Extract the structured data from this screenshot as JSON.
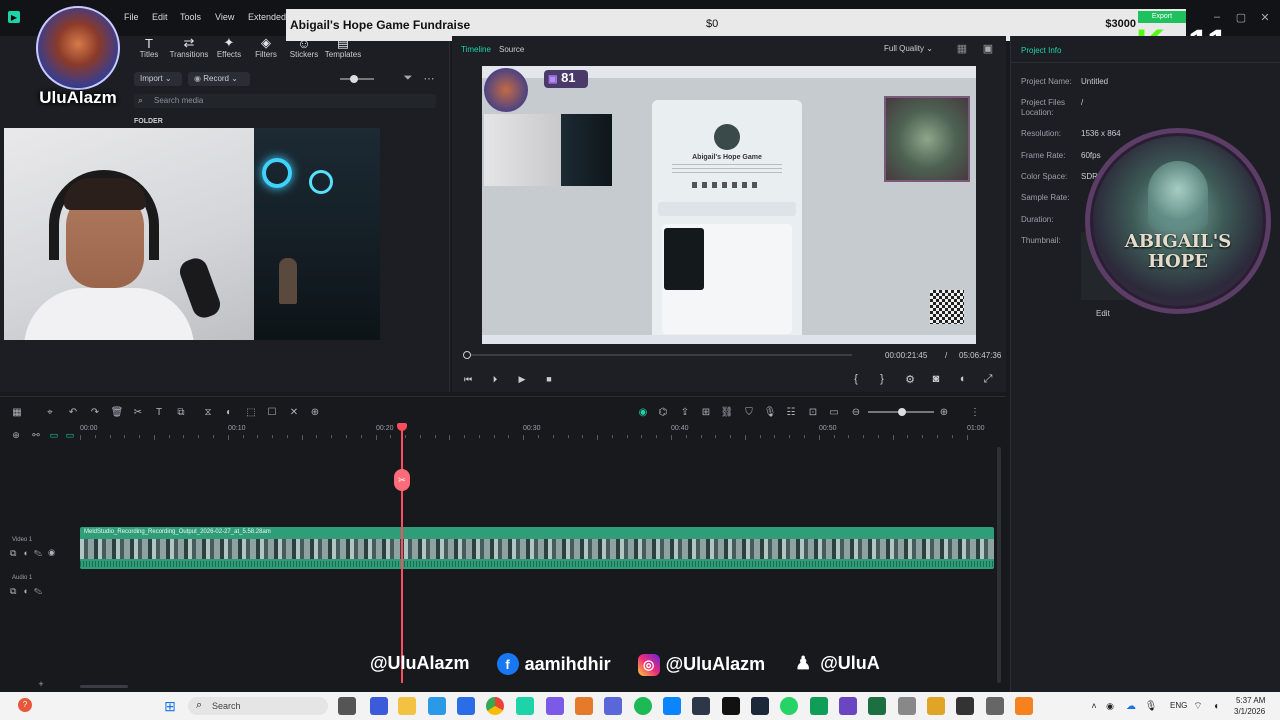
{
  "menu": [
    "File",
    "Edit",
    "Tools",
    "View",
    "Extended"
  ],
  "fundraiser": {
    "title": "Abigail's Hope Game Fundraise",
    "raised": "$0",
    "goal": "$3000",
    "bar_label": "Export"
  },
  "kick_count": "11",
  "channel_name": "UluAlazm",
  "toolbar": [
    {
      "label": "Titles",
      "icon": "T"
    },
    {
      "label": "Transitions",
      "icon": "⇄"
    },
    {
      "label": "Effects",
      "icon": "✦"
    },
    {
      "label": "Filters",
      "icon": "◈"
    },
    {
      "label": "Stickers",
      "icon": "☺"
    },
    {
      "label": "Templates",
      "icon": "▤"
    }
  ],
  "media": {
    "import_label": "Import",
    "record_label": "Record",
    "search_placeholder": "Search media",
    "folder_label": "FOLDER"
  },
  "preview": {
    "tabs": [
      "Timeline",
      "Source"
    ],
    "quality": "Full Quality",
    "current_time": "00:00:21:45",
    "total_time": "05:06:47:36",
    "twitch_viewers": "81",
    "card_title": "Abigail's Hope Game"
  },
  "project_info": {
    "header": "Project Info",
    "fields": [
      {
        "label": "Project Name:",
        "value": "Untitled"
      },
      {
        "label": "Project Files Location:",
        "value": "/"
      },
      {
        "label": "Resolution:",
        "value": "1536 x 864"
      },
      {
        "label": "Frame Rate:",
        "value": "60fps"
      },
      {
        "label": "Color Space:",
        "value": "SDR"
      },
      {
        "label": "Sample Rate:",
        "value": ""
      },
      {
        "label": "Duration:",
        "value": ""
      },
      {
        "label": "Thumbnail:",
        "value": ""
      }
    ],
    "edit_label": "Edit",
    "logo_text_1": "ABIGAIL'S",
    "logo_text_2": "HOPE"
  },
  "timeline": {
    "ruler": [
      "00:00",
      "00:10",
      "00:20",
      "00:30",
      "00:40",
      "00:50",
      "01:00"
    ],
    "clip_name": "MeldStudio_Recording_Recording_Output_2026-02-27_at_5.58.28am",
    "tracks": [
      "Video 1",
      "Audio 1"
    ],
    "playhead_fraction": 0.35
  },
  "socials": [
    {
      "icon": "none",
      "text": "@UluAlazm"
    },
    {
      "icon": "facebook-icon",
      "text": "aamihdhir"
    },
    {
      "icon": "instagram-icon",
      "text": "@UluAlazm"
    },
    {
      "icon": "snapchat-icon",
      "text": "@UluA"
    }
  ],
  "taskbar": {
    "search_label": "Search",
    "lang": "ENG",
    "time": "5:37 AM",
    "date": "3/1/2026"
  },
  "colors": {
    "accent": "#1dd3a7",
    "clip": "#2f9e78",
    "playhead": "#ff4d5e",
    "kick_green": "#53fc18"
  }
}
